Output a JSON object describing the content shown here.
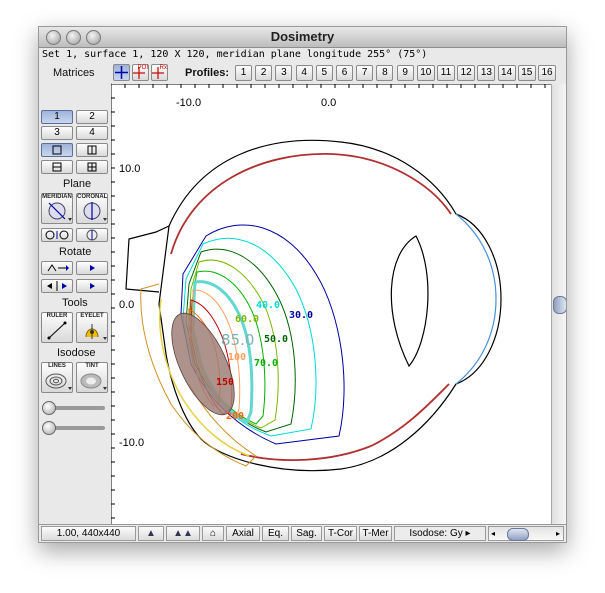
{
  "window": {
    "title": "Dosimetry"
  },
  "info_line": "Set 1, surface 1, 120 X 120, meridian plane longitude 255° (75°)",
  "toolbar": {
    "matrices_label": "Matrices",
    "profiles_label": "Profiles:",
    "tool_poi_caption": "POI",
    "tool_rx_caption": "Rx",
    "profiles": [
      "1",
      "2",
      "3",
      "4",
      "5",
      "6",
      "7",
      "8",
      "9",
      "10",
      "11",
      "12",
      "13",
      "14",
      "15",
      "16"
    ]
  },
  "sidebar": {
    "matrix_buttons": [
      "1",
      "2",
      "3",
      "4"
    ],
    "plane_label": "Plane",
    "meridian_caption": "MERIDIAN",
    "coronal_caption": "CORONAL",
    "rotate_label": "Rotate",
    "tools_label": "Tools",
    "ruler_caption": "RULER",
    "eyelet_caption": "EYELET",
    "isodose_label": "Isodose",
    "lines_caption": "LINES",
    "tint_caption": "TINT"
  },
  "axes": {
    "x_ticks": [
      "-10.0",
      "0.0"
    ],
    "y_ticks": [
      "10.0",
      "0.0",
      "-10.0"
    ]
  },
  "isodose_labels": [
    {
      "text": "40.0",
      "color": "#00d8d8"
    },
    {
      "text": "30.0",
      "color": "#0000a0"
    },
    {
      "text": "60.0",
      "color": "#7ab800"
    },
    {
      "text": "50.0",
      "color": "#006400"
    },
    {
      "text": "85.0",
      "color": "#7fb0b0"
    },
    {
      "text": "70.0",
      "color": "#00b000"
    },
    {
      "text": "100",
      "color": "#ffa060"
    },
    {
      "text": "150",
      "color": "#c00000"
    },
    {
      "text": "200",
      "color": "#ff6000"
    }
  ],
  "status": {
    "zoom": "1.00, 440x440",
    "axial": "Axial",
    "eq": "Eq.",
    "sag": "Sag.",
    "tcor": "T-Cor",
    "tmer": "T-Mer",
    "isodose_unit": "Isodose: Gy"
  }
}
